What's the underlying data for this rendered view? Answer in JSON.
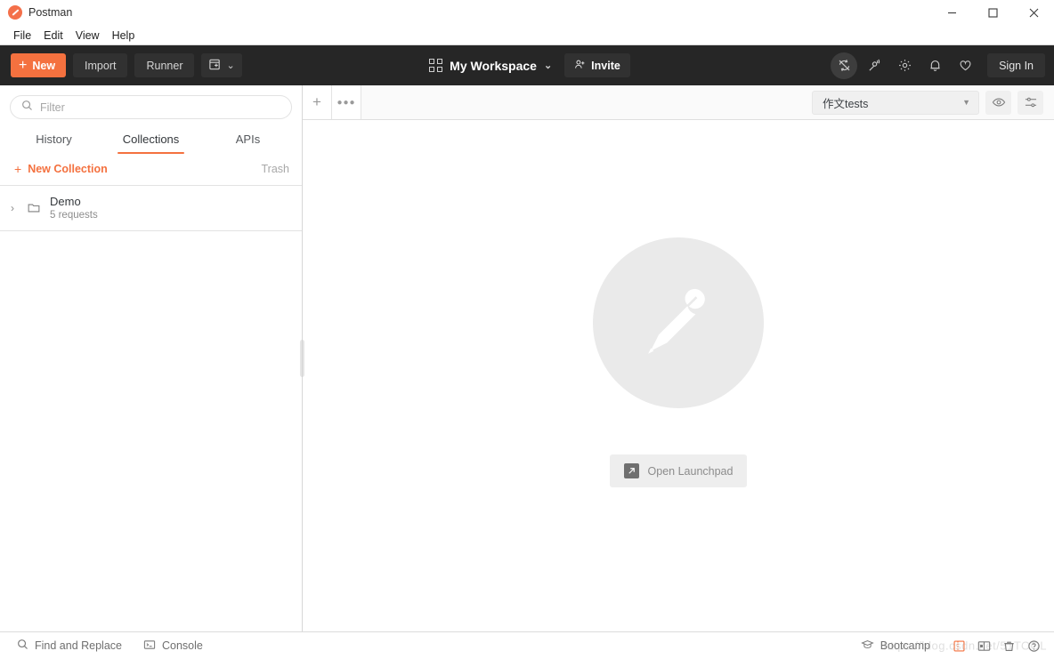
{
  "window": {
    "app_title": "Postman",
    "logo_color": "#f4704a",
    "minimize_label": "Minimize",
    "maximize_label": "Maximize",
    "close_label": "Close"
  },
  "menubar": {
    "items": [
      {
        "label": "File"
      },
      {
        "label": "Edit"
      },
      {
        "label": "View"
      },
      {
        "label": "Help"
      }
    ]
  },
  "topnav": {
    "accent_color": "#f4713f",
    "background_color": "#262626",
    "new_label": "New",
    "import_label": "Import",
    "runner_label": "Runner",
    "new_window_label": "",
    "workspace_label": "My Workspace",
    "invite_label": "Invite",
    "signin_label": "Sign In",
    "icons": [
      {
        "name": "sync-off-icon"
      },
      {
        "name": "satellite-icon"
      },
      {
        "name": "gear-icon"
      },
      {
        "name": "bell-icon"
      },
      {
        "name": "heart-icon"
      }
    ]
  },
  "sidebar": {
    "filter_placeholder": "Filter",
    "filter_value": "",
    "tabs": [
      {
        "label": "History",
        "active": false
      },
      {
        "label": "Collections",
        "active": true
      },
      {
        "label": "APIs",
        "active": false
      }
    ],
    "new_collection_label": "New Collection",
    "trash_label": "Trash",
    "collections": [
      {
        "name": "Demo",
        "subtitle": "5 requests"
      }
    ]
  },
  "main": {
    "tab_add_label": "+",
    "tab_more_label": "000",
    "environment": {
      "selected": "作文tests",
      "eye_icon": "eye-icon",
      "settings_icon": "sliders-icon"
    },
    "empty_state": {
      "logo_name": "postman-logo-watermark",
      "launchpad_label": "Open Launchpad"
    }
  },
  "statusbar": {
    "find_replace_label": "Find and Replace",
    "console_label": "Console",
    "bootcamp_label": "Bootcamp",
    "watermark_text": "https://blog.csdn.net/51TOOL",
    "right_icons": [
      {
        "name": "single-pane-layout-icon",
        "accent": true
      },
      {
        "name": "two-pane-layout-icon",
        "accent": false
      },
      {
        "name": "trash-icon",
        "accent": false
      },
      {
        "name": "help-icon",
        "accent": false
      }
    ]
  }
}
